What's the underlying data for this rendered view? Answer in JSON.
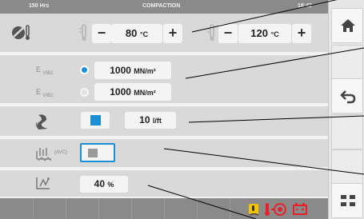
{
  "status_bar": {
    "hours": "150 Hrs",
    "mode": "COMPACTION",
    "clock": "18:42"
  },
  "temperature": {
    "left": {
      "value": "80",
      "unit": "°C",
      "minus": "−",
      "plus": "+"
    },
    "right": {
      "value": "120",
      "unit": "°C",
      "minus": "−",
      "plus": "+"
    }
  },
  "vibration": [
    {
      "label_main": "E",
      "label_sub": "VIB1",
      "value": "1000",
      "unit": "MN/m²",
      "selected": true
    },
    {
      "label_main": "E",
      "label_sub": "VIB2",
      "value": "1000",
      "unit": "MN/m²",
      "selected": false
    }
  ],
  "flow": {
    "value": "10",
    "unit": "l/ft"
  },
  "avc": {
    "label": "(AVC)",
    "enabled": false
  },
  "percentage": {
    "value": "40",
    "unit": "%"
  },
  "sidebar": {
    "buttons": [
      "home-icon",
      "back-icon",
      "grid-menu-icon"
    ]
  },
  "warnings": {
    "icons": [
      "oil-temp-warning-icon",
      "brake-warning-icon",
      "battery-warning-icon"
    ],
    "color": "#e8202a",
    "oil_color": "#f2c500"
  },
  "colors": {
    "accent": "#1a8fd6",
    "panel": "#d9d9d9",
    "bar": "#8a8a8a"
  }
}
